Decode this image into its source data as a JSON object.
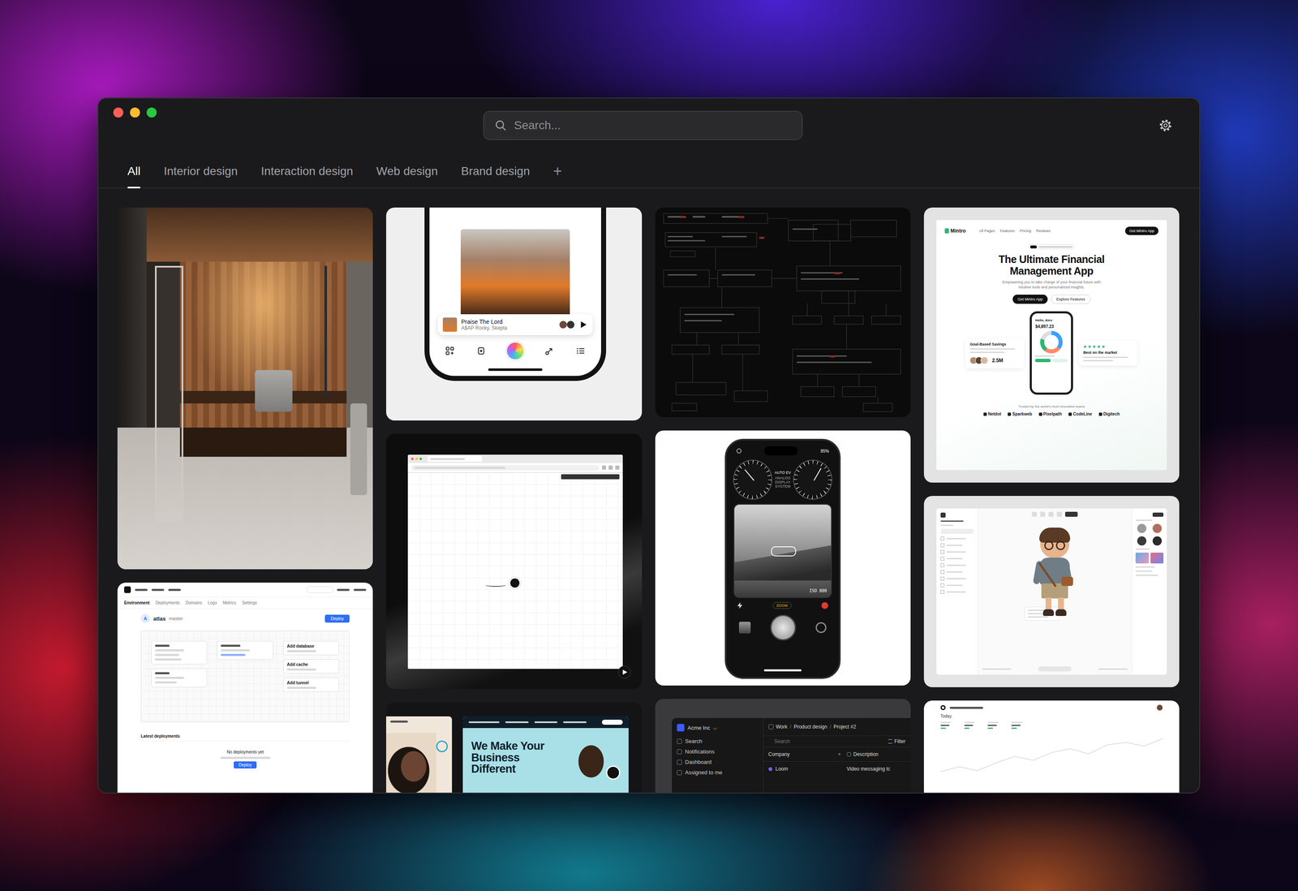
{
  "search": {
    "placeholder": "Search..."
  },
  "tabs": [
    {
      "label": "All",
      "selected": true
    },
    {
      "label": "Interior design",
      "selected": false
    },
    {
      "label": "Interaction design",
      "selected": false
    },
    {
      "label": "Web design",
      "selected": false
    },
    {
      "label": "Brand design",
      "selected": false
    }
  ],
  "add_tab": "+",
  "columns": [
    {
      "cards": [
        {
          "kind": "sauna-photo"
        },
        {
          "kind": "deploy-dashboard",
          "nav": [
            "Environment",
            "Deployments",
            "Domains",
            "Logs",
            "Metrics",
            "Settings"
          ],
          "avatar": "A",
          "project": "atlas",
          "branch": "master",
          "button": "Deploy",
          "actions": [
            "Add database",
            "Add cache",
            "Add tunnel"
          ],
          "section": "Latest deployments",
          "empty_title": "No deployments yet",
          "empty_button": "Deploy"
        }
      ]
    },
    {
      "cards": [
        {
          "kind": "music-player",
          "track": "Praise The Lord",
          "artist": "A$AP Rocky, Skepta"
        },
        {
          "kind": "canvas-video"
        },
        {
          "kind": "agency-sites",
          "headline": "We Make Your Business Different"
        }
      ]
    },
    {
      "cards": [
        {
          "kind": "diagram"
        },
        {
          "kind": "camera-phone",
          "battery": "85%",
          "mode": "AUTO EV",
          "system": "ANALOG DISPLAY SYSTEM",
          "iso": "ISO 800",
          "zoom": "ZOOM"
        },
        {
          "kind": "crm-app",
          "workspace": "Acme Inc",
          "menu": [
            "Search",
            "Notifications",
            "Dashboard",
            "Assigned to me"
          ],
          "breadcrumb": [
            "Work",
            "Product design",
            "Project #2"
          ],
          "separator": "/",
          "search_placeholder": "Search",
          "filter": "Filter",
          "columns": [
            "Company",
            "Description"
          ],
          "add_column": "+",
          "rows": [
            {
              "company": "Loom",
              "description": "Video messaging tc",
              "color": "#7b5cff"
            }
          ]
        }
      ]
    },
    {
      "cards": [
        {
          "kind": "landing-page",
          "brand": "Mintro",
          "links": [
            "All Pages",
            "Features",
            "Pricing",
            "Reviews"
          ],
          "nav_button": "Get Mintro App",
          "headline": "The Ultimate Financial Management App",
          "subtitle": "Empowering you to take charge of your financial future with intuitive tools and personalized insights.",
          "primary": "Get Mintro App",
          "secondary": "Explore Features",
          "left_card": {
            "title": "Goal-Based Savings",
            "stat": "2.5M"
          },
          "phone": {
            "greeting": "Hello, Alex",
            "balance": "$4,897.23"
          },
          "right_card": {
            "title": "Best on the market",
            "stars": 5
          },
          "trusted": "Trusted by the world's most innovative teams",
          "logos": [
            "Netdot",
            "Sparkweb",
            "Pixelpath",
            "CodeLine",
            "Digitech"
          ]
        },
        {
          "kind": "editor-3d",
          "swatches": [
            "#9a9a9a",
            "#b07060",
            "#3a3a3a",
            "#2a2a2a"
          ]
        },
        {
          "kind": "analytics",
          "period": "Today",
          "chart": [
            40,
            44,
            41,
            47,
            52,
            49,
            55,
            58,
            54,
            61,
            63,
            60,
            66
          ]
        }
      ]
    }
  ]
}
